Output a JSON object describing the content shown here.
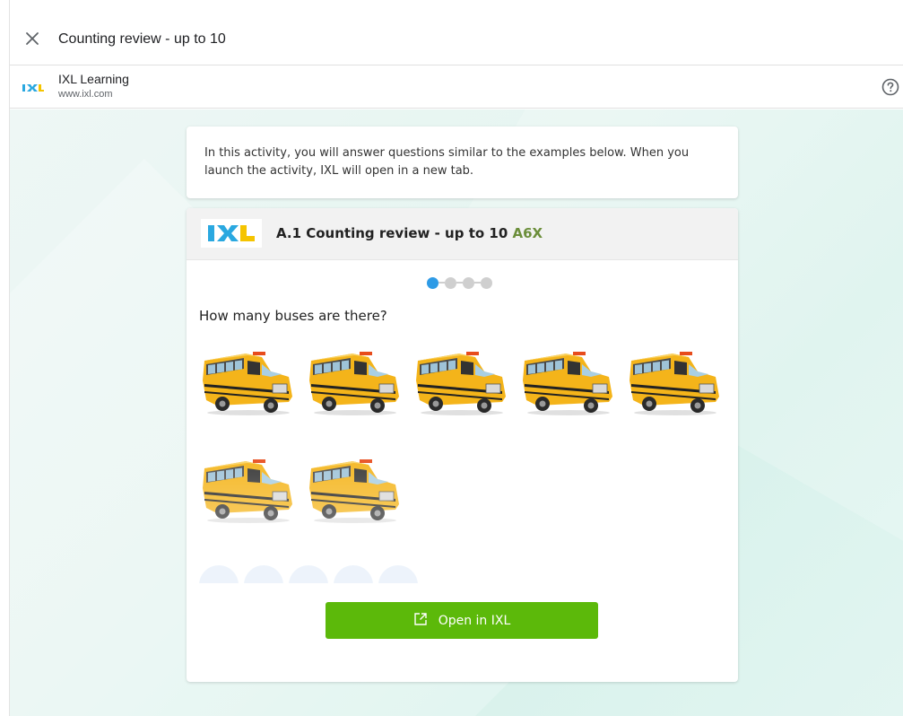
{
  "header": {
    "title": "Counting review - up to 10",
    "close_icon": "close-icon"
  },
  "source": {
    "logo_icon": "ixl-logo-icon",
    "name": "IXL Learning",
    "url": "www.ixl.com",
    "help_icon": "help-icon"
  },
  "intro": {
    "text": "In this activity, you will answer questions similar to the examples below. When you launch the activity, IXL will open in a new tab."
  },
  "skill": {
    "logo_text": "IXL",
    "title": "A.1 Counting review - up to 10",
    "code": "A6X"
  },
  "carousel": {
    "total": 4,
    "active_index": 0
  },
  "question": {
    "text": "How many buses are there?",
    "bus_count": 7,
    "item_icon": "school-bus-icon"
  },
  "actions": {
    "open_label": "Open in IXL",
    "open_icon": "external-link-icon"
  },
  "colors": {
    "accent_green": "#5cb90a",
    "active_dot": "#2e9be6",
    "skill_code": "#6b8e3a",
    "ixl_blue": "#2aa8e0",
    "ixl_yellow": "#f5c400"
  }
}
